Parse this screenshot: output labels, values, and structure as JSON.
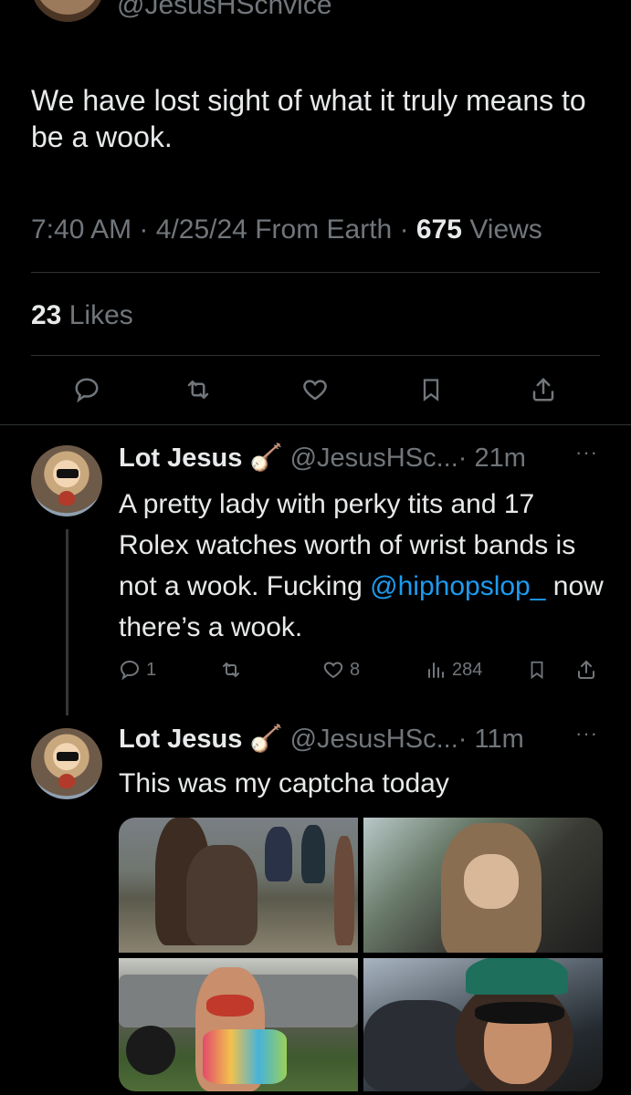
{
  "top_tweet": {
    "handle": "@JesusHSchvice",
    "text": "We have lost sight of what it truly means to be a wook.",
    "time": "7:40 AM",
    "date": "4/25/24",
    "source": "From Earth",
    "sep": "·",
    "views_count": "675",
    "views_label": "Views",
    "likes_count": "23",
    "likes_label": "Likes"
  },
  "replies": [
    {
      "name": "Lot Jesus",
      "emoji": "🪕",
      "handle": "@JesusHSc...",
      "time": "· 21m",
      "more": "···",
      "text_before": "A pretty lady with perky tits and 17 Rolex watches worth of wrist bands is not a wook. Fucking ",
      "mention": "@hiphopslop_",
      "text_after": " now there’s a wook.",
      "reply_count": "1",
      "like_count": "8",
      "views_count": "284"
    },
    {
      "name": "Lot Jesus",
      "emoji": "🪕",
      "handle": "@JesusHSc...",
      "time": "· 11m",
      "more": "···",
      "text": "This was my captcha today"
    }
  ],
  "icons": [
    "reply-icon",
    "retweet-icon",
    "like-icon",
    "bookmark-icon",
    "share-icon",
    "views-icon",
    "more-icon"
  ],
  "colors": {
    "background": "#000000",
    "text": "#e7e9ea",
    "muted": "#71767b",
    "link": "#1d9bf0",
    "divider": "#2f3336"
  }
}
